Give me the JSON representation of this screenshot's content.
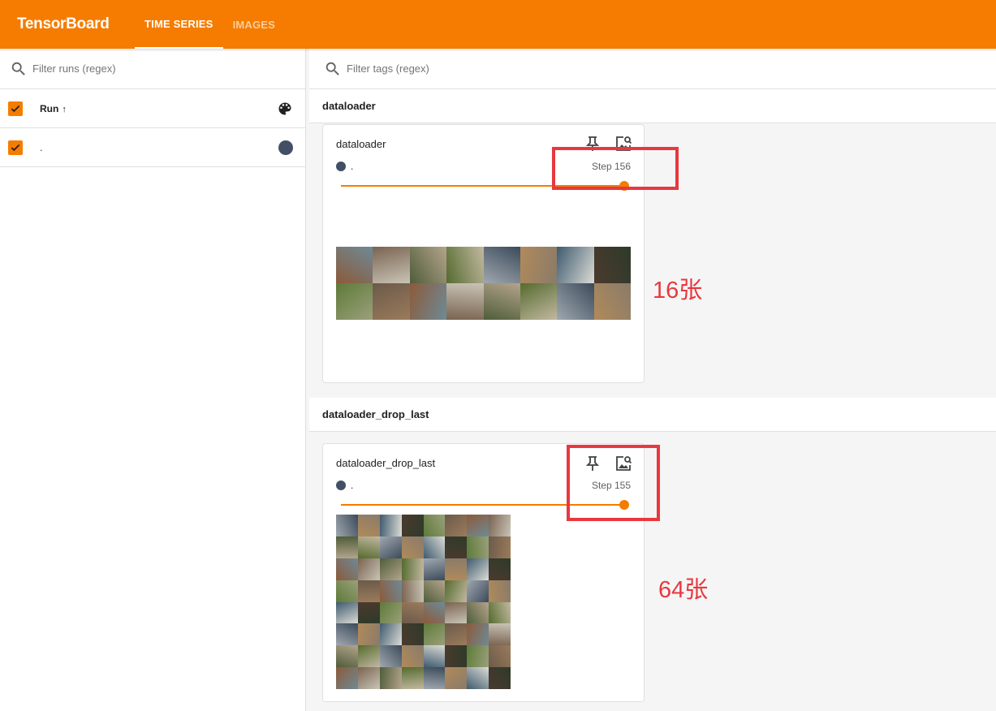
{
  "app": {
    "title": "TensorBoard",
    "tabs": [
      {
        "label": "TIME SERIES",
        "active": true
      },
      {
        "label": "IMAGES",
        "active": false
      }
    ]
  },
  "sidebar": {
    "filter_placeholder": "Filter runs (regex)",
    "header_label": "Run",
    "sort_icon": "arrow-up-icon",
    "runs": [
      {
        "name": ".",
        "checked": true,
        "color": "#425066"
      }
    ]
  },
  "main": {
    "tag_filter_placeholder": "Filter tags (regex)",
    "groups": [
      {
        "name": "dataloader",
        "card": {
          "title": "dataloader",
          "run": ".",
          "step_label": "Step 156",
          "slider_value": 1.0,
          "icons": [
            "pin-icon",
            "image-search-icon"
          ]
        }
      },
      {
        "name": "dataloader_drop_last",
        "card": {
          "title": "dataloader_drop_last",
          "run": ".",
          "step_label": "Step 155",
          "slider_value": 1.0,
          "icons": [
            "pin-icon",
            "image-search-icon"
          ]
        }
      }
    ]
  },
  "annotations": [
    "16张",
    "64张"
  ],
  "colors": {
    "accent": "#f57c00",
    "run_color": "#425066",
    "annotation_red": "#e8383f"
  }
}
